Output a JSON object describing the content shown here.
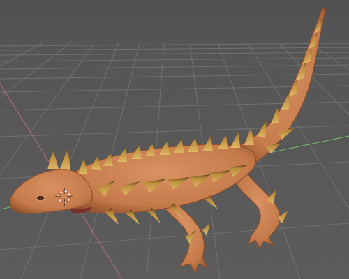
{
  "viewport": {
    "background_color": "#5a5a5a",
    "grid_color": "#767676",
    "axis_x_color": "#b4727c",
    "axis_y_color": "#6fc06f",
    "cursor_colors": [
      "#d23a2a",
      "#ffffff"
    ]
  },
  "model": {
    "skin_color": "#c57a4a",
    "skin_shadow_color": "#8e4f2c",
    "spike_color": "#caa04c",
    "spike_tip_color": "#5a3a18",
    "eye_color": "#5a2a16",
    "mouth_color": "#7a2f2a"
  },
  "icons": {
    "cursor": "3d-cursor-icon"
  }
}
